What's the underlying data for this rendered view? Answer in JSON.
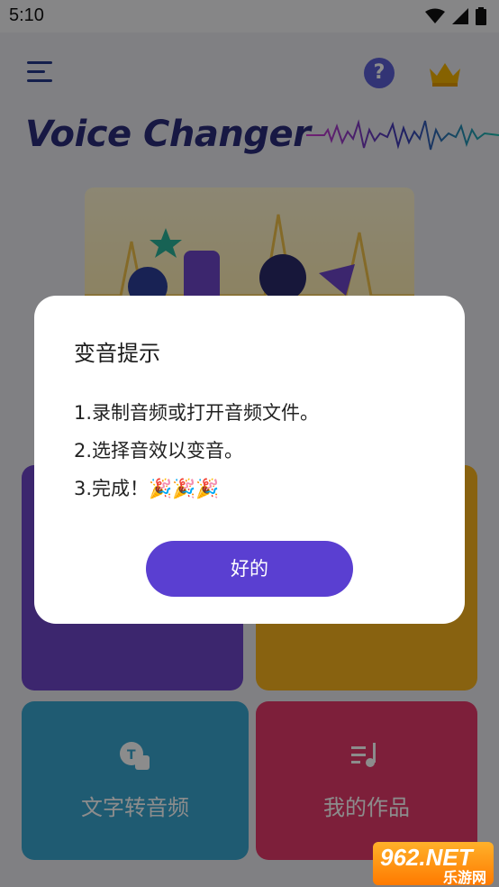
{
  "status": {
    "time": "5:10"
  },
  "app": {
    "title": "Voice Changer"
  },
  "cards": [
    {
      "label": "",
      "color": "#6d45c8"
    },
    {
      "label": "",
      "color": "#f7b21e"
    },
    {
      "label": "文字转音频",
      "color": "#3aa6cf",
      "icon": "text-to-speech-icon"
    },
    {
      "label": "我的作品",
      "color": "#e43a6a",
      "icon": "music-list-icon"
    }
  ],
  "dialog": {
    "title": "变音提示",
    "lines": [
      "1.录制音频或打开音频文件。",
      "2.选择音效以变音。",
      "3.完成！🎉🎉🎉"
    ],
    "confirm_label": "好的"
  },
  "watermark": {
    "number": "962.NET",
    "sub": "乐游网"
  },
  "colors": {
    "accent": "#5a3fd1",
    "title": "#2a2d7a"
  }
}
